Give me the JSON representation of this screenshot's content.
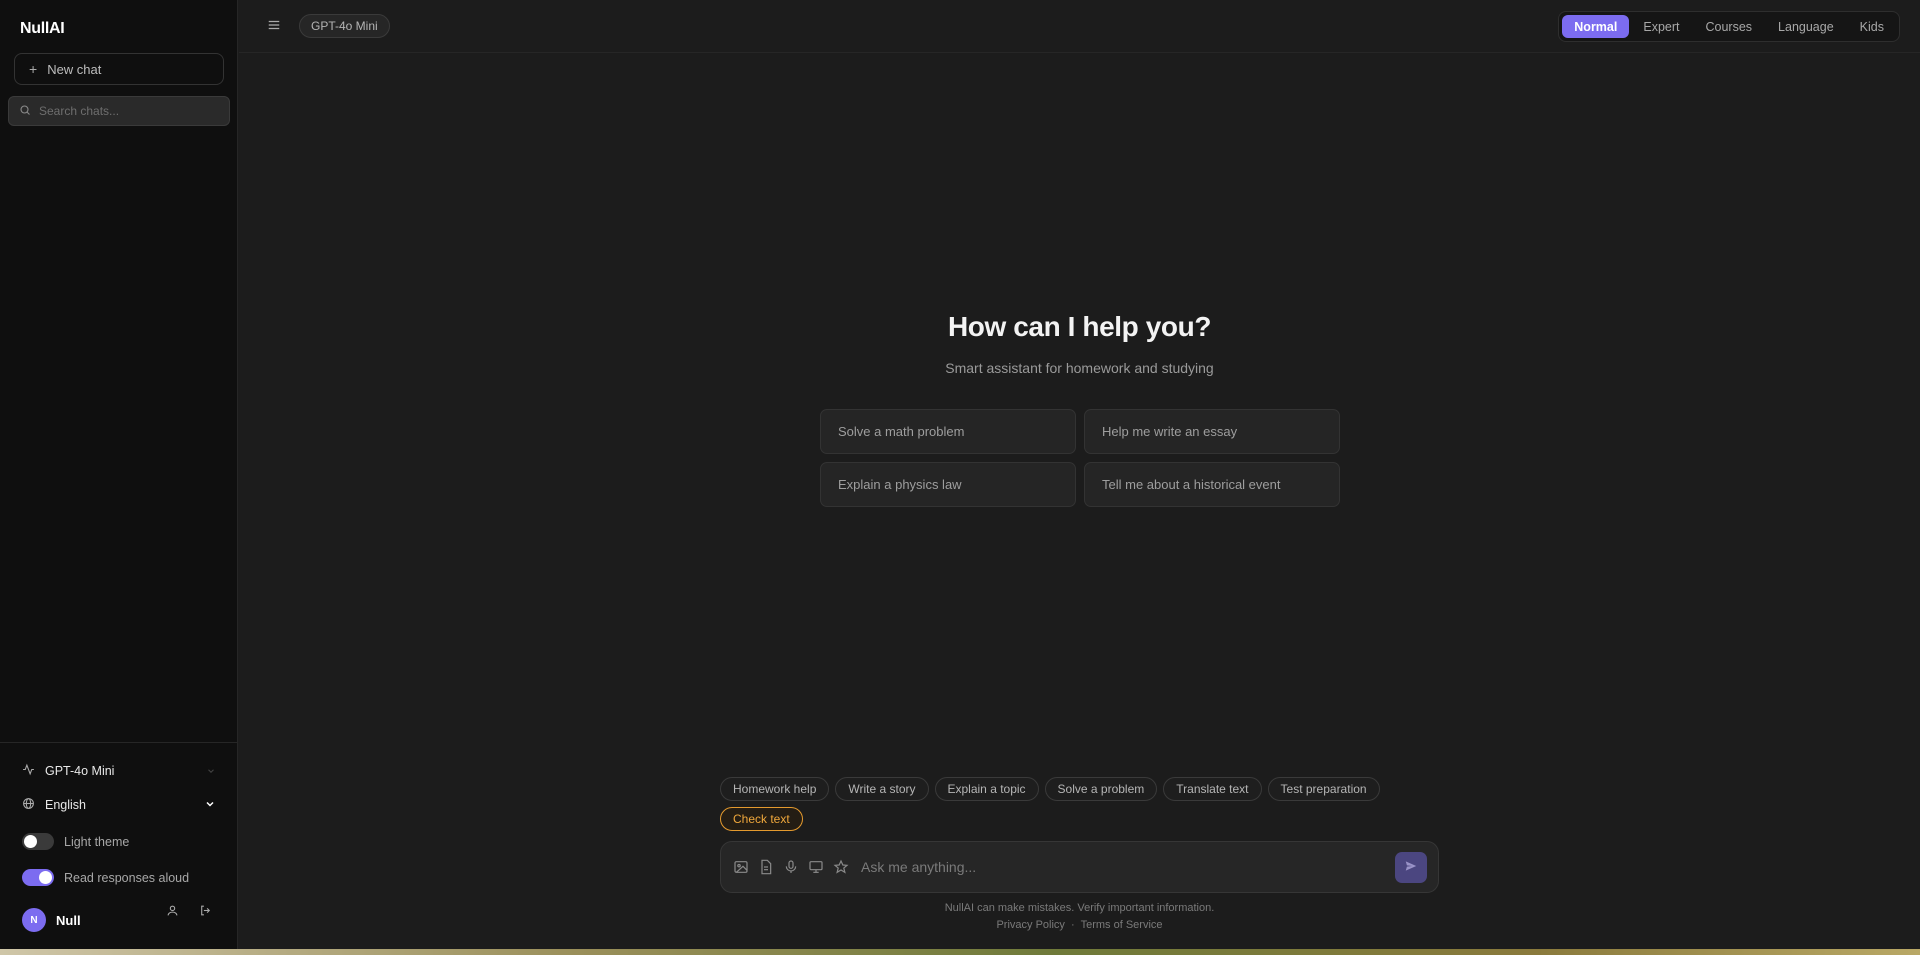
{
  "app": {
    "logo": "NullAI"
  },
  "sidebar": {
    "new_chat_label": "New chat",
    "search_placeholder": "Search chats...",
    "model_label": "GPT-4o Mini",
    "language_label": "English",
    "light_theme_label": "Light theme",
    "light_theme_on": false,
    "read_aloud_label": "Read responses aloud",
    "read_aloud_on": true,
    "user": {
      "initial": "N",
      "name": "Null"
    }
  },
  "header": {
    "model_chip": "GPT-4o Mini",
    "modes": [
      "Normal",
      "Expert",
      "Courses",
      "Language",
      "Kids"
    ],
    "active_mode": "Normal"
  },
  "hero": {
    "title": "How can I help you?",
    "subtitle": "Smart assistant for homework and studying",
    "suggestions": [
      "Solve a math problem",
      "Help me write an essay",
      "Explain a physics law",
      "Tell me about a historical event"
    ]
  },
  "quick_actions": [
    "Homework help",
    "Write a story",
    "Explain a topic",
    "Solve a problem",
    "Translate text",
    "Test preparation",
    "Check text"
  ],
  "composer": {
    "placeholder": "Ask me anything..."
  },
  "footer": {
    "disclaimer": "NullAI can make mistakes. Verify important information.",
    "privacy": "Privacy Policy",
    "separator": "·",
    "terms": "Terms of Service"
  },
  "colors": {
    "accent": "#7c6cf0",
    "highlight_chip": "#e49a2e",
    "background": "#1c1c1c",
    "sidebar": "#0f0f0f"
  }
}
